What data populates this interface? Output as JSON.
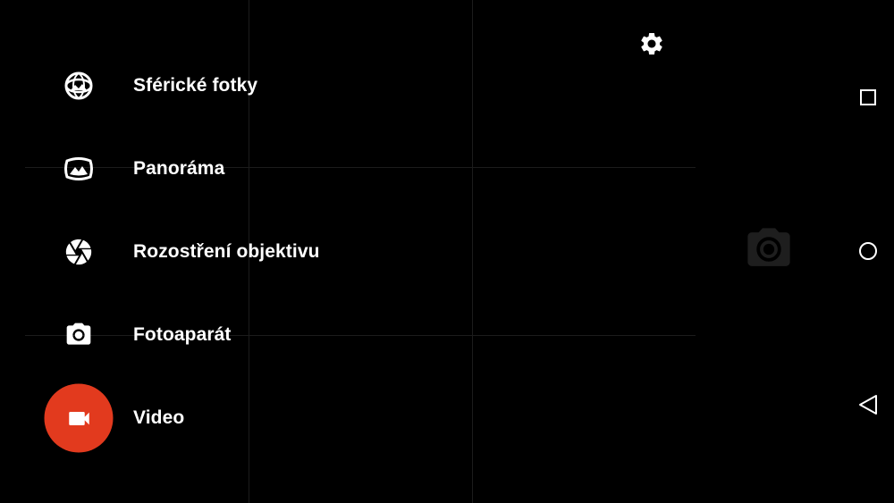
{
  "modes": [
    {
      "label": "Sférické fotky",
      "icon": "photosphere-icon"
    },
    {
      "label": "Panoráma",
      "icon": "panorama-icon"
    },
    {
      "label": "Rozostření objektivu",
      "icon": "lens-blur-icon"
    },
    {
      "label": "Fotoaparát",
      "icon": "camera-icon"
    },
    {
      "label": "Video",
      "icon": "video-icon",
      "active": true
    }
  ],
  "settings": {
    "icon": "gear-icon"
  },
  "shutter": {
    "icon": "camera-icon",
    "state": "disabled"
  },
  "navigation": {
    "recents": {
      "icon": "square-icon"
    },
    "home": {
      "icon": "circle-icon"
    },
    "back": {
      "icon": "triangle-back-icon"
    }
  },
  "colors": {
    "background": "#000000",
    "accent": "#e23a1e",
    "text": "#ffffff",
    "grid": "#1c1c1c"
  }
}
